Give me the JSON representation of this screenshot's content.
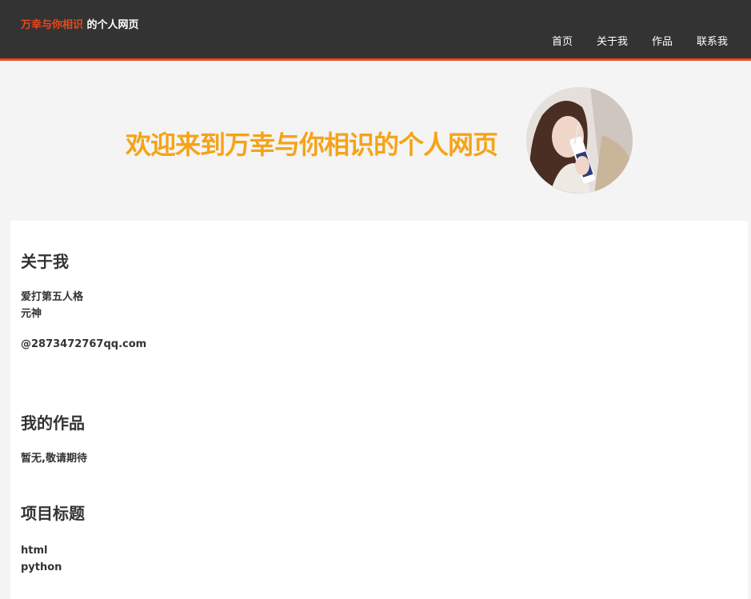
{
  "header": {
    "logo_highlight": "万幸与你相识",
    "logo_rest": " 的个人网页",
    "nav": [
      "首页",
      "关于我",
      "作品",
      "联系我"
    ]
  },
  "showcase": {
    "title": "欢迎来到万幸与你相识的个人网页"
  },
  "about": {
    "heading": "关于我",
    "lines": [
      "爱打第五人格",
      "元神"
    ],
    "email": "@2873472767qq.com"
  },
  "works": {
    "heading": "我的作品",
    "text": "暂无,敬请期待"
  },
  "projects": {
    "heading": "项目标题",
    "items": [
      "html",
      "python"
    ]
  },
  "colors": {
    "accent": "#e8491d",
    "title": "#f6a316",
    "header_bg": "#333333"
  }
}
